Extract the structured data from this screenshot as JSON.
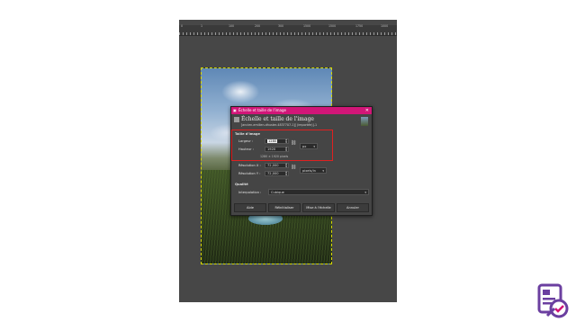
{
  "ruler_ticks": [
    "0",
    "1",
    "100",
    "200",
    "300",
    "1500",
    "1500",
    "1750",
    "1000"
  ],
  "dialog": {
    "window_title": "Échelle et taille de l'image",
    "close_glyph": "✕",
    "heading": "Échelle et taille de l'image",
    "subtitle": "[ancien-emilien-dhuster-4837707-1][ (importée)]-1",
    "section_size": "Taille d'image",
    "width_label": "Largeur :",
    "width_value": "1280",
    "height_label": "Hauteur :",
    "height_value": "1920",
    "unit": "px",
    "pixel_size": "1280 × 1920 pixels",
    "res_x_label": "Résolution X :",
    "res_x_value": "72,000",
    "res_y_label": "Résolution Y :",
    "res_y_value": "72,000",
    "res_unit": "pixels/in",
    "section_quality": "Qualité",
    "interp_label": "Interpolation :",
    "interp_value": "Cubique",
    "buttons": {
      "help": "Aide",
      "reset": "Réinitialiser",
      "scale": "Mise à l'échelle",
      "cancel": "Annuler"
    }
  },
  "icons": {
    "chain": "link-icon",
    "dropdown": "chevron-down-icon"
  }
}
